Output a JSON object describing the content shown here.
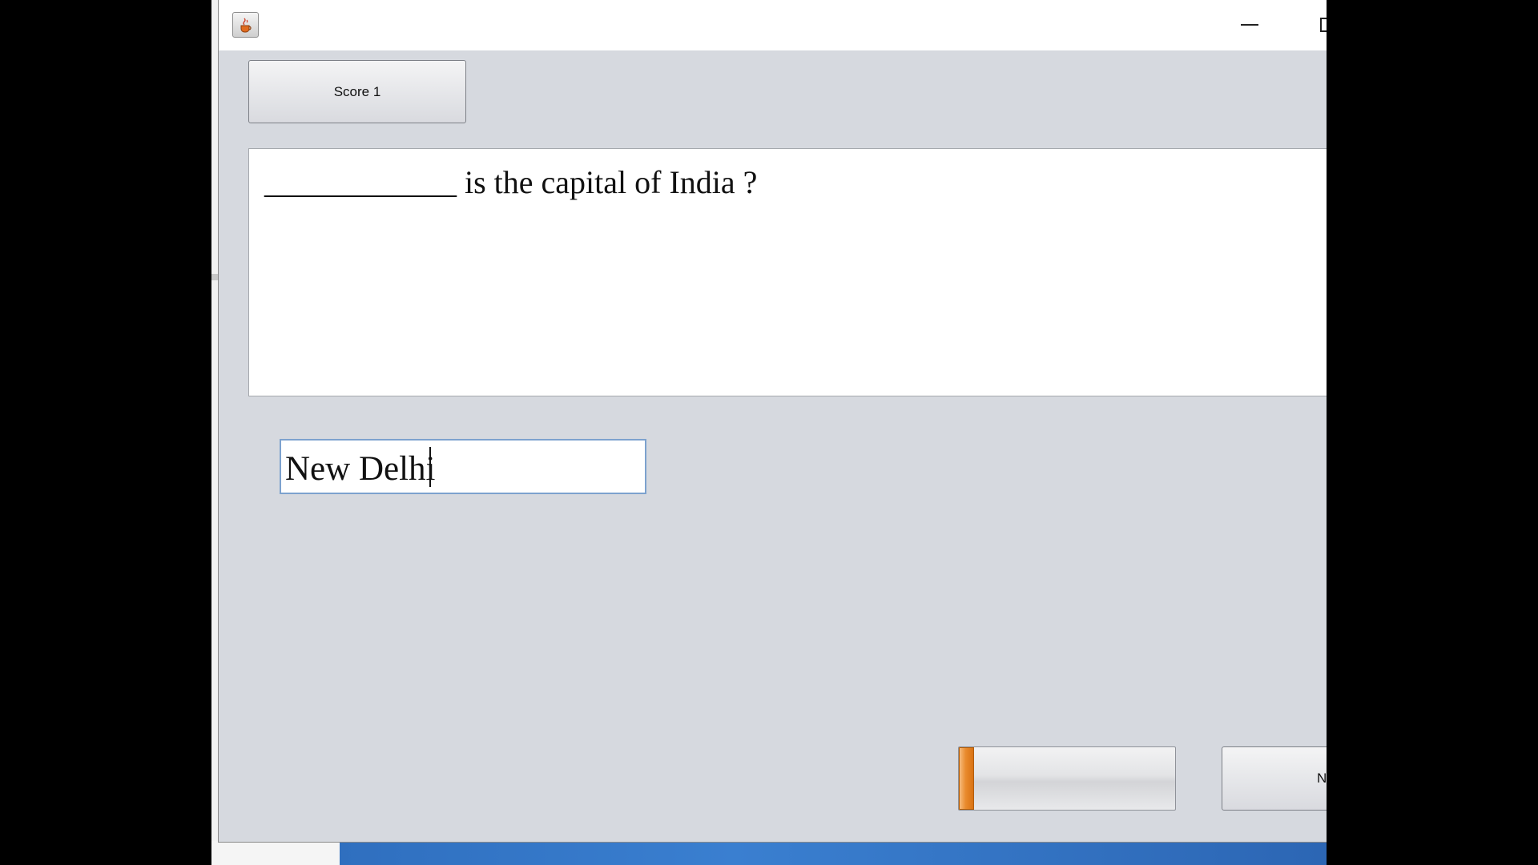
{
  "window": {
    "icon": "java-coffee-cup-icon"
  },
  "toolbar": {
    "score_label": "Score 1"
  },
  "question": {
    "text": "____________ is the capital of India ?"
  },
  "answer": {
    "value": "New Delhi"
  },
  "progress": {
    "fraction": 0.07,
    "color": "#e98a2c"
  },
  "footer": {
    "next_label": "N"
  },
  "colors": {
    "window_bg": "#d6d9df",
    "taskbar_blue": "#2f6fbf"
  }
}
